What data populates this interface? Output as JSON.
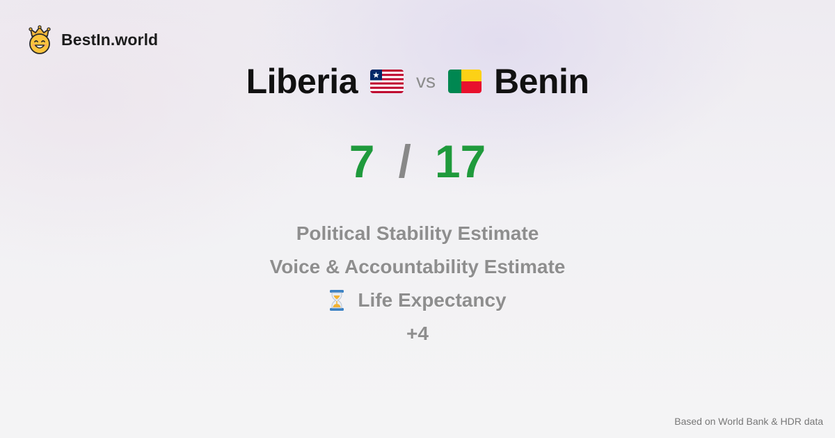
{
  "brand": {
    "name": "BestIn.world",
    "icon": "crown-smiley-icon"
  },
  "comparison": {
    "left": {
      "name": "Liberia",
      "flag": "liberia-flag-icon",
      "score": "7"
    },
    "separator": "vs",
    "right": {
      "name": "Benin",
      "flag": "benin-flag-icon",
      "score": "17"
    },
    "score_separator": "/"
  },
  "criteria": [
    {
      "label": "Political Stability Estimate"
    },
    {
      "label": "Voice & Accountability Estimate"
    },
    {
      "label": "Life Expectancy",
      "icon": "hourglass-icon"
    },
    {
      "label": "+4"
    }
  ],
  "footer": {
    "note": "Based on World Bank & HDR data"
  },
  "colors": {
    "score": "#1f9a3c",
    "muted": "#8e8e8e",
    "title": "#111111"
  }
}
